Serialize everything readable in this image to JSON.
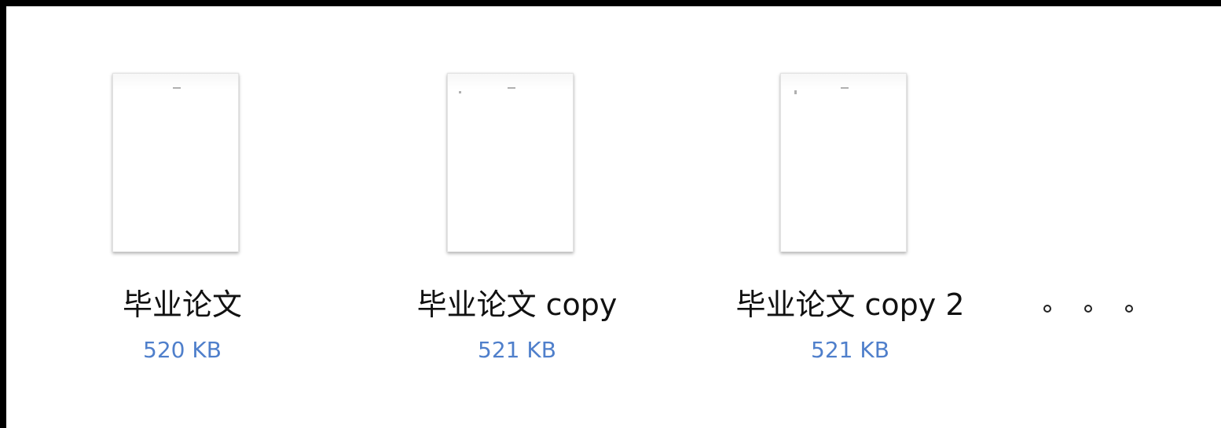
{
  "files": [
    {
      "name": "毕业论文",
      "size": "520 KB"
    },
    {
      "name": "毕业论文 copy",
      "size": "521 KB"
    },
    {
      "name": "毕业论文 copy 2",
      "size": "521 KB"
    }
  ],
  "icons": {
    "thumbnail": "document-thumbnail-icon",
    "more": "ellipsis-icon"
  },
  "colors": {
    "frame": "#000000",
    "background": "#ffffff",
    "filename": "#111111",
    "filesize": "#4f7fcb"
  }
}
